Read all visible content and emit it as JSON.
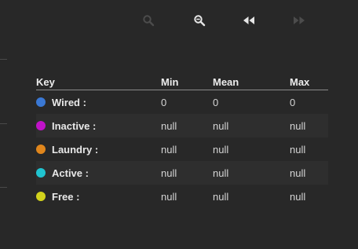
{
  "toolbar": {
    "buttons": [
      {
        "name": "zoom-in-icon",
        "enabled": false
      },
      {
        "name": "zoom-out-icon",
        "enabled": true
      },
      {
        "name": "rewind-icon",
        "enabled": true
      },
      {
        "name": "fast-forward-icon",
        "enabled": false
      }
    ]
  },
  "colors": {
    "background": "#282828",
    "row_alt": "#2e2e2e",
    "icon_enabled": "#e6e6e6",
    "icon_disabled": "#4c4c4c"
  },
  "legend": {
    "headers": {
      "key": "Key",
      "min": "Min",
      "mean": "Mean",
      "max": "Max"
    },
    "rows": [
      {
        "label": "Wired :",
        "color": "#3a78d4",
        "min": "0",
        "mean": "0",
        "max": "0"
      },
      {
        "label": "Inactive :",
        "color": "#c012c8",
        "min": "null",
        "mean": "null",
        "max": "null"
      },
      {
        "label": "Laundry :",
        "color": "#e0861c",
        "min": "null",
        "mean": "null",
        "max": "null"
      },
      {
        "label": "Active :",
        "color": "#20c4d0",
        "min": "null",
        "mean": "null",
        "max": "null"
      },
      {
        "label": "Free :",
        "color": "#d2d21c",
        "min": "null",
        "mean": "null",
        "max": "null"
      }
    ]
  }
}
